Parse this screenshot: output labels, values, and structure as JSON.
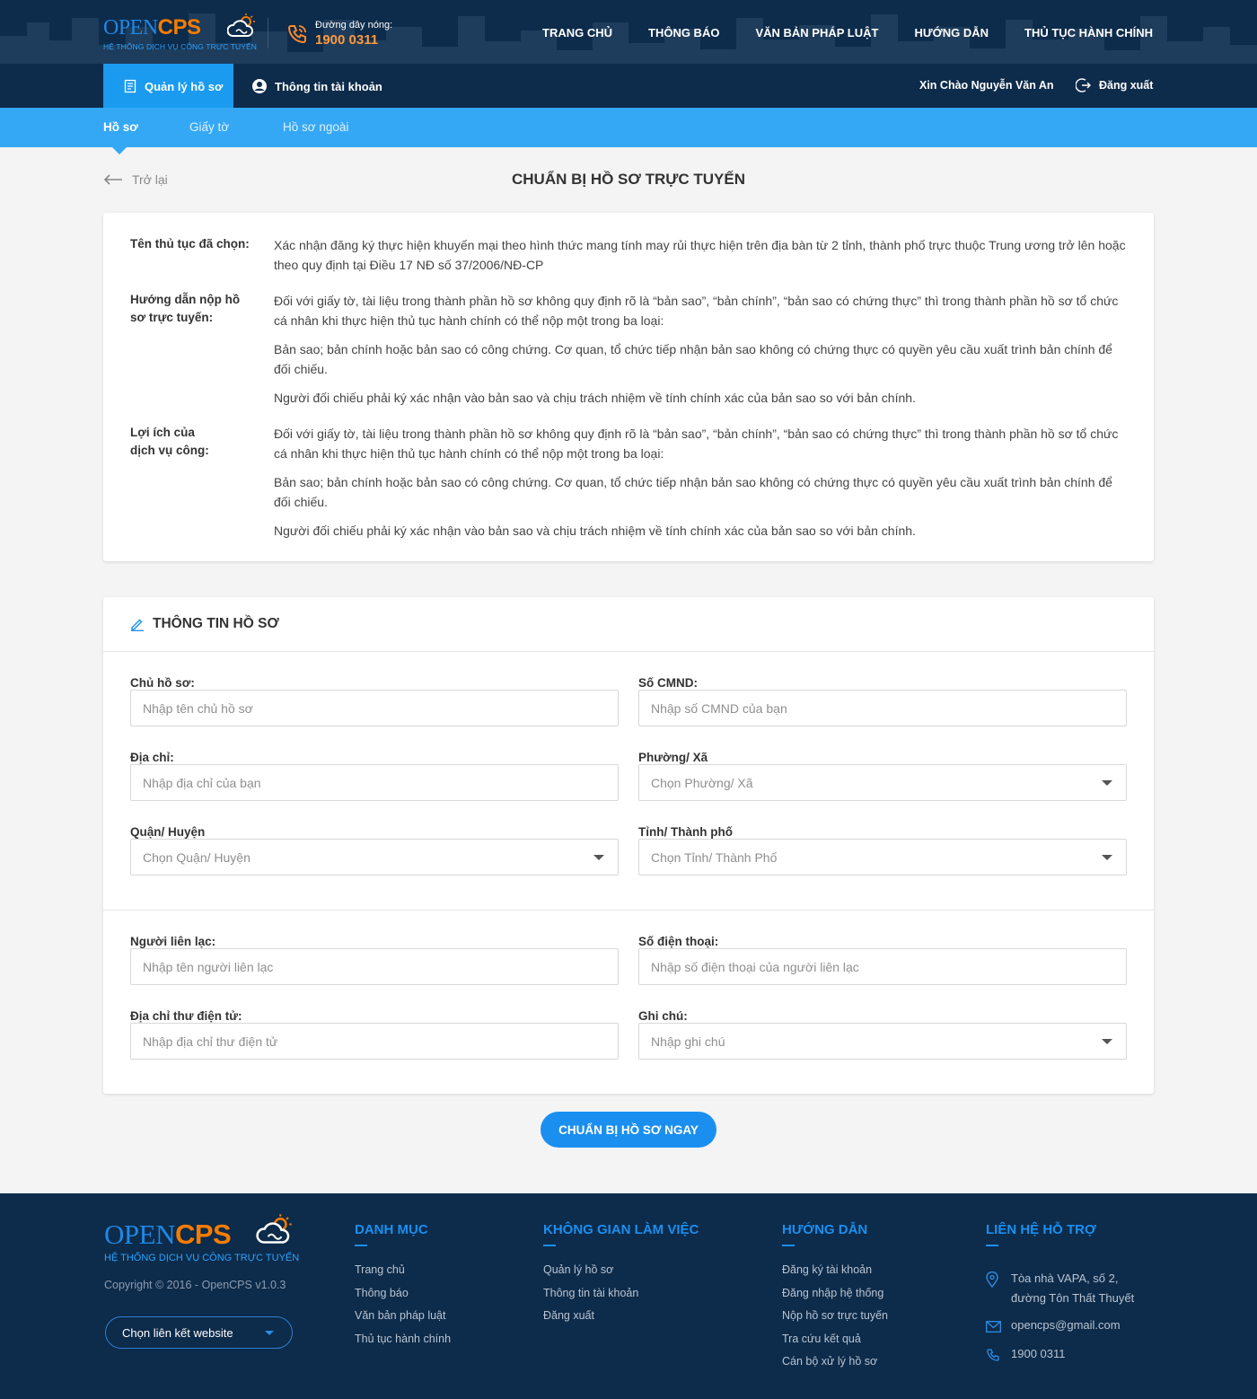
{
  "brand": {
    "name_open": "OPEN",
    "name_cps": "CPS",
    "tagline": "HỆ THỐNG DỊCH VỤ CÔNG TRỰC TUYẾN"
  },
  "hotline": {
    "label": "Đường dây nóng:",
    "number": "1900 0311"
  },
  "main_nav": [
    "TRANG CHỦ",
    "THÔNG BÁO",
    "VĂN BẢN PHÁP LUẬT",
    "HƯỚNG DẪN",
    "THỦ TỤC HÀNH CHÍNH"
  ],
  "subnav": {
    "manage": "Quản lý hồ sơ",
    "account": "Thông tin tài khoản",
    "greeting": "Xin Chào Nguyễn Văn An",
    "logout": "Đăng xuất"
  },
  "tabs": [
    "Hồ sơ",
    "Giấy tờ",
    "Hồ sơ ngoài"
  ],
  "back_label": "Trở lại",
  "page_title": "CHUẨN BỊ HỒ SƠ TRỰC TUYẾN",
  "info": {
    "procedure_label": "Tên thủ tục đã chọn:",
    "procedure_value": "Xác nhận đăng ký thực hiện khuyến mại theo hình thức mang tính may rủi thực hiện trên địa bàn từ 2 tỉnh, thành phố trực thuộc Trung ương trở lên hoặc theo quy định tại Điều 17 NĐ số 37/2006/NĐ-CP",
    "guide_label": "Hướng dẫn nộp hồ sơ trực tuyến:",
    "guide_paragraphs": [
      "Đối với giấy tờ, tài liệu trong thành phần hồ sơ không quy định rõ là “bản sao”, “bản chính”, “bản sao có chứng thực” thì trong thành phần hồ sơ tổ chức cá nhân khi thực hiện thủ tục hành chính có thể nộp một trong ba loại:",
      "Bản sao; bản chính hoặc bản sao có công chứng. Cơ quan, tổ chức tiếp nhận bản sao không có chứng thực có quyền yêu cầu xuất trình bản chính để đối chiếu.",
      "Người đối chiếu phải ký xác nhận vào bản sao và chịu trách nhiệm về tính chính xác của bản sao so với bản chính."
    ],
    "benefit_label": "Lợi ích của dịch vụ công:",
    "benefit_paragraphs": [
      "Đối với giấy tờ, tài liệu trong thành phần hồ sơ không quy định rõ là “bản sao”, “bản chính”, “bản sao có chứng thực” thì trong thành phần hồ sơ tổ chức cá nhân khi thực hiện thủ tục hành chính có thể nộp một trong ba loại:",
      "Bản sao; bản chính hoặc bản sao có công chứng. Cơ quan, tổ chức tiếp nhận bản sao không có chứng thực có quyền yêu cầu xuất trình bản chính để đối chiếu.",
      "Người đối chiếu phải ký xác nhận vào bản sao và chịu trách nhiệm về tính chính xác của bản sao so với bản chính."
    ]
  },
  "form": {
    "title": "THÔNG TIN HỒ SƠ",
    "owner": {
      "label": "Chủ hồ sơ:",
      "placeholder": "Nhập tên chủ hồ sơ",
      "value": ""
    },
    "id_number": {
      "label": "Số CMND:",
      "placeholder": "Nhập số CMND của bạn",
      "value": ""
    },
    "address": {
      "label": "Địa chỉ:",
      "placeholder": "Nhập địa chỉ của bạn",
      "value": ""
    },
    "ward": {
      "label": "Phường/ Xã",
      "selected": "Chọn Phường/ Xã"
    },
    "district": {
      "label": "Quận/ Huyện",
      "selected": "Chọn Quận/ Huyện"
    },
    "province": {
      "label": "Tỉnh/ Thành phố",
      "selected": "Chọn Tỉnh/ Thành Phố"
    },
    "contact": {
      "label": "Người liên lạc:",
      "placeholder": "Nhập tên người liên lạc",
      "value": ""
    },
    "phone": {
      "label": "Số điện thoại:",
      "placeholder": "Nhập số điện thoại của người liên lạc",
      "value": ""
    },
    "email": {
      "label": "Địa chỉ thư điện tử:",
      "placeholder": "Nhập địa chỉ thư điện tử",
      "value": ""
    },
    "note": {
      "label": "Ghi chú:",
      "selected": "Nhập ghi chú"
    },
    "submit": "CHUẨN BỊ HỒ SƠ NGAY"
  },
  "footer": {
    "copyright": "Copyright © 2016 - OpenCPS v1.0.3",
    "link_select": "Chọn liên kết website",
    "columns": [
      {
        "title": "DANH MỤC",
        "links": [
          "Trang chủ",
          "Thông báo",
          "Văn bản pháp luật",
          "Thủ tục hành chính"
        ]
      },
      {
        "title": "KHÔNG GIAN LÀM VIỆC",
        "links": [
          "Quản lý hồ sơ",
          "Thông tin tài khoản",
          "Đăng xuất"
        ]
      },
      {
        "title": "HƯỚNG DẪN",
        "links": [
          "Đăng ký tài khoản",
          "Đăng nhập hệ thống",
          "Nộp hồ sơ trực tuyến",
          "Tra cứu kết quả",
          "Cán bộ xử lý hồ sơ"
        ]
      }
    ],
    "support": {
      "title": "LIÊN HỆ HỖ TRỢ",
      "address_line1": "Tòa nhà VAPA, số 2,",
      "address_line2": "đường Tôn Thất Thuyết",
      "email": "opencps@gmail.com",
      "phone": "1900 0311"
    }
  },
  "colors": {
    "navy": "#0d2b4a",
    "accent_blue": "#1a9bf0",
    "tab_blue": "#35a8f5",
    "orange": "#f57c00"
  }
}
